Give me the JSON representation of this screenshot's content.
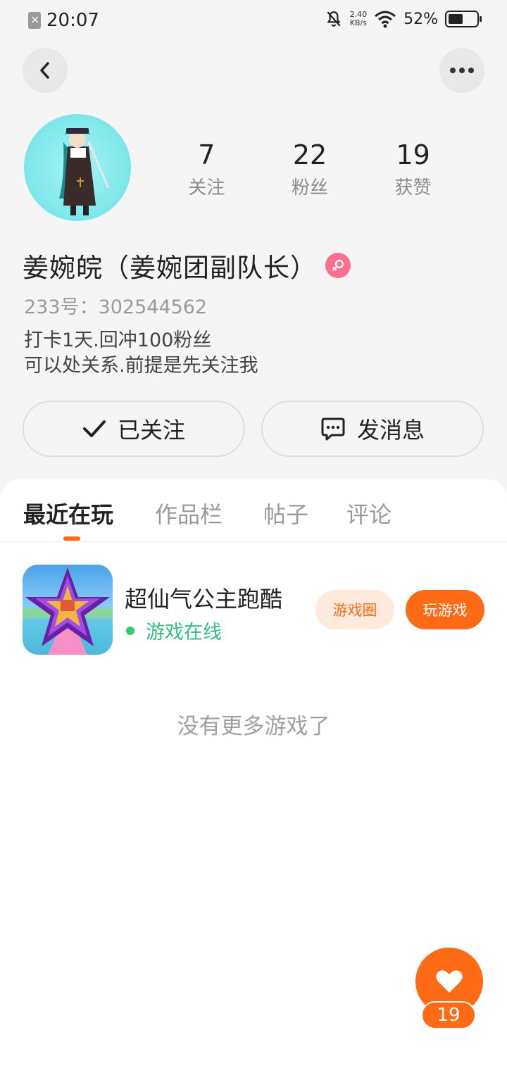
{
  "status_bar": {
    "time": "20:07",
    "net_speed_value": "2.40",
    "net_speed_unit": "KB/s",
    "battery_percent": "52%",
    "battery_level": 0.52
  },
  "nav": {
    "back_icon": "chevron-left-icon",
    "more_icon": "more-dots-icon"
  },
  "profile": {
    "name": "姜婉皖（姜婉团副队长）",
    "gender": "female",
    "id_label": "233号：",
    "id_value": "302544562",
    "bio_line1": "打卡1天.回冲100粉丝",
    "bio_line2": "可以处关系.前提是先关注我",
    "stats": [
      {
        "value": "7",
        "label": "关注"
      },
      {
        "value": "22",
        "label": "粉丝"
      },
      {
        "value": "19",
        "label": "获赞"
      }
    ]
  },
  "actions": {
    "follow_label": "已关注",
    "message_label": "发消息"
  },
  "tabs": [
    {
      "label": "最近在玩",
      "active": true
    },
    {
      "label": "作品栏",
      "active": false
    },
    {
      "label": "帖子",
      "active": false
    },
    {
      "label": "评论",
      "active": false
    }
  ],
  "games": [
    {
      "name": "超仙气公主跑酷",
      "status": "游戏在线",
      "circle_label": "游戏圈",
      "play_label": "玩游戏"
    }
  ],
  "no_more_text": "没有更多游戏了",
  "like": {
    "count": "19"
  },
  "colors": {
    "accent": "#ff6a14",
    "online": "#2ec17a",
    "gender_female": "#ff6f8e"
  }
}
